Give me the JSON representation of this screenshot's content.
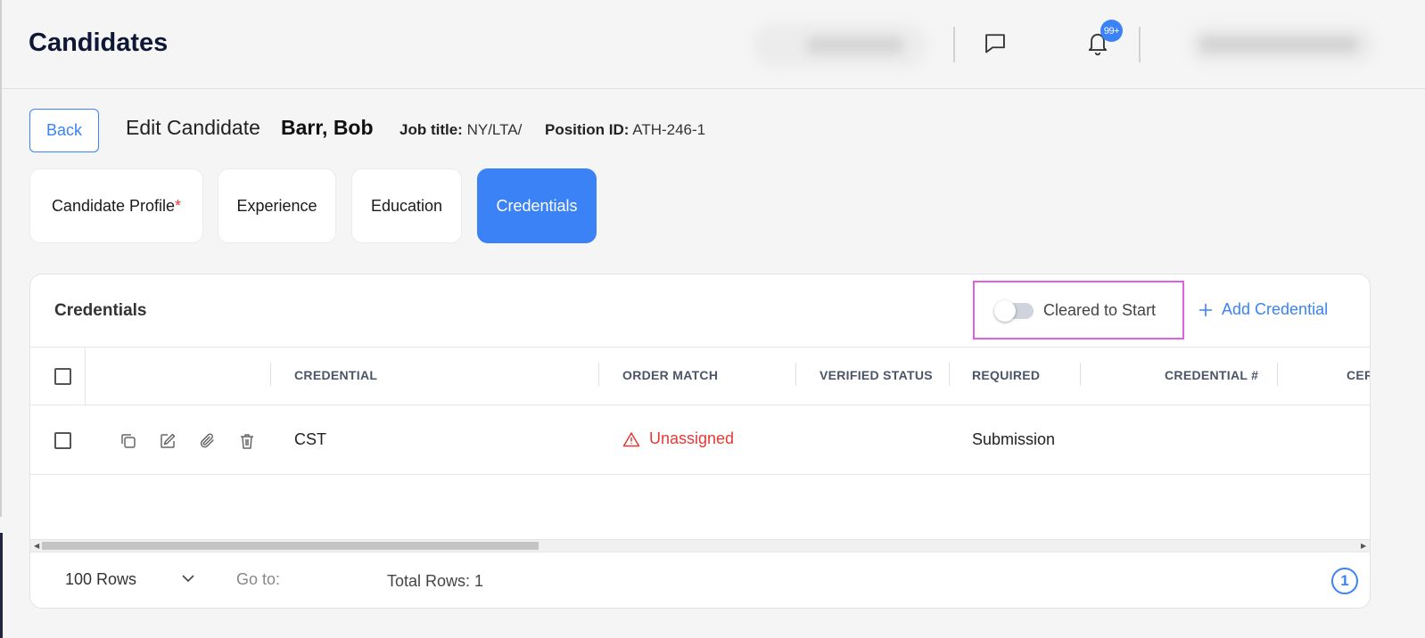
{
  "header": {
    "title": "Candidates",
    "notifications_badge": "99+"
  },
  "edit": {
    "back_label": "Back",
    "edit_label": "Edit Candidate",
    "candidate_name": "Barr, Bob",
    "job_title_label": "Job title:",
    "job_title_value": "NY/LTA/",
    "position_id_label": "Position ID:",
    "position_id_value": "ATH-246-1"
  },
  "tabs": [
    {
      "label": "Candidate Profile",
      "required_mark": "*",
      "active": false
    },
    {
      "label": "Experience",
      "active": false
    },
    {
      "label": "Education",
      "active": false
    },
    {
      "label": "Credentials",
      "active": true
    }
  ],
  "credentials": {
    "section_title": "Credentials",
    "cleared_to_start_label": "Cleared to Start",
    "cleared_to_start_on": false,
    "add_label": "Add Credential",
    "columns": [
      "CREDENTIAL",
      "ORDER MATCH",
      "VERIFIED STATUS",
      "REQUIRED",
      "CREDENTIAL #",
      "CER"
    ],
    "rows": [
      {
        "credential": "CST",
        "order_match": "Unassigned",
        "verified_status": "",
        "required": "Submission",
        "credential_number": ""
      }
    ]
  },
  "footer": {
    "rows_per_page": "100 Rows",
    "goto_label": "Go to:",
    "total_rows": "Total Rows: 1",
    "current_page": "1"
  },
  "colors": {
    "accent": "#3b82f6",
    "danger": "#e53935",
    "highlight": "#e060e0",
    "title": "#0f1736"
  }
}
